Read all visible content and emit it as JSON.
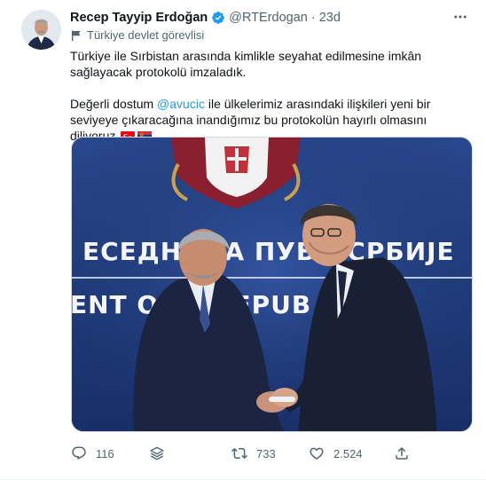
{
  "tweet": {
    "author_name": "Recep Tayyip Erdoğan",
    "handle": "@RTErdogan",
    "separator": "·",
    "time": "23d",
    "label": "Türkiye devlet görevlisi",
    "text_line1": "Türkiye ile Sırbistan arasında kimlikle seyahat edilmesine imkân sağlayacak protokolü imzaladık.",
    "text_p2_before": "Değerli dostum ",
    "mention": "@avucic",
    "text_p2_after": " ile ülkelerimiz arasındaki ilişkileri yeni bir seviyeye çıkaracağına inandığımız bu protokolün hayırlı olmasını diliyoruz.",
    "flag_emojis": [
      "flag-turkey-icon",
      "flag-serbia-icon"
    ]
  },
  "media": {
    "banner_top": "ЕСЕДНИКА   ПУБЛ   СРБИЈЕ",
    "banner_bottom": "ENT OF   E REPUB   SERB",
    "colors": {
      "backdrop": "#1b3574",
      "backdrop_light": "#2c4c94"
    }
  },
  "actions": {
    "reply_count": "116",
    "retweet_count": "733",
    "like_count": "2.524"
  },
  "colors": {
    "accent": "#1d9bf0",
    "muted": "#536471",
    "text": "#0f1419"
  }
}
